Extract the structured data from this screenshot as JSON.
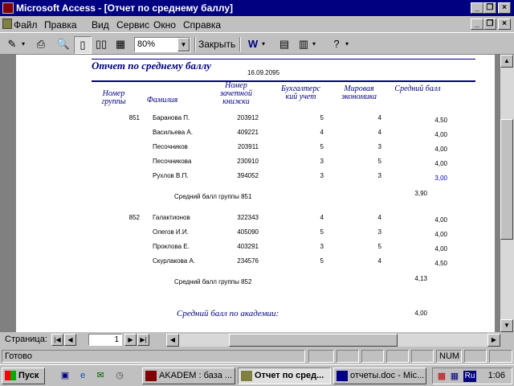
{
  "window": {
    "title": "Microsoft Access - [Отчет по среднему баллу]"
  },
  "menu": [
    "Файл",
    "Правка",
    "Вид",
    "Сервис",
    "Окно",
    "Справка"
  ],
  "toolbar": {
    "zoom_value": "80%",
    "close_label": "Закрыть"
  },
  "report": {
    "title": "Отчет по среднему баллу",
    "date": "16.09.2095",
    "headers": {
      "group_no": "Номер группы",
      "surname": "Фамилия",
      "record_book": "Номер зачетной книжки",
      "accounting": "Бухгалтерс кий учет",
      "world_economy": "Мировая экономика",
      "avg": "Средний балл"
    },
    "groups": [
      {
        "number": "851",
        "rows": [
          {
            "surname": "Баранова П.",
            "book": "203912",
            "acc": "5",
            "eco": "4",
            "avg": "4,50"
          },
          {
            "surname": "Васильева А.",
            "book": "409221",
            "acc": "4",
            "eco": "4",
            "avg": "4,00"
          },
          {
            "surname": "Песочников",
            "book": "203911",
            "acc": "5",
            "eco": "3",
            "avg": "4,00"
          },
          {
            "surname": "Песочникова",
            "book": "230910",
            "acc": "3",
            "eco": "5",
            "avg": "4,00"
          },
          {
            "surname": "Рухлов В.П.",
            "book": "394052",
            "acc": "3",
            "eco": "3",
            "avg": "3,00"
          }
        ],
        "summary_label": "Средний балл группы 851",
        "summary_value": "3,90"
      },
      {
        "number": "852",
        "rows": [
          {
            "surname": "Галактионов",
            "book": "322343",
            "acc": "4",
            "eco": "4",
            "avg": "4,00"
          },
          {
            "surname": "Олегов И.И.",
            "book": "405090",
            "acc": "5",
            "eco": "3",
            "avg": "4,00"
          },
          {
            "surname": "Проклова Е.",
            "book": "403291",
            "acc": "3",
            "eco": "5",
            "avg": "4,00"
          },
          {
            "surname": "Скурлакова А.",
            "book": "234576",
            "acc": "5",
            "eco": "4",
            "avg": "4,50"
          }
        ],
        "summary_label": "Средний балл группы 852",
        "summary_value": "4,13"
      }
    ],
    "academy_label": "Средний балл по академии:",
    "academy_value": "4,00"
  },
  "nav": {
    "page_label": "Страница:",
    "page_value": "1"
  },
  "status": {
    "text": "Готово",
    "num": "NUM"
  },
  "taskbar": {
    "start": "Пуск",
    "tasks": [
      "AKADEM : база ...",
      "Отчет по сред...",
      "отчеты.doc - Mic..."
    ],
    "lang": "Ru",
    "clock": "1:06"
  },
  "colors": {
    "titlebar": "#000080",
    "report_accent": "#000080",
    "face": "#c0c0c0"
  }
}
